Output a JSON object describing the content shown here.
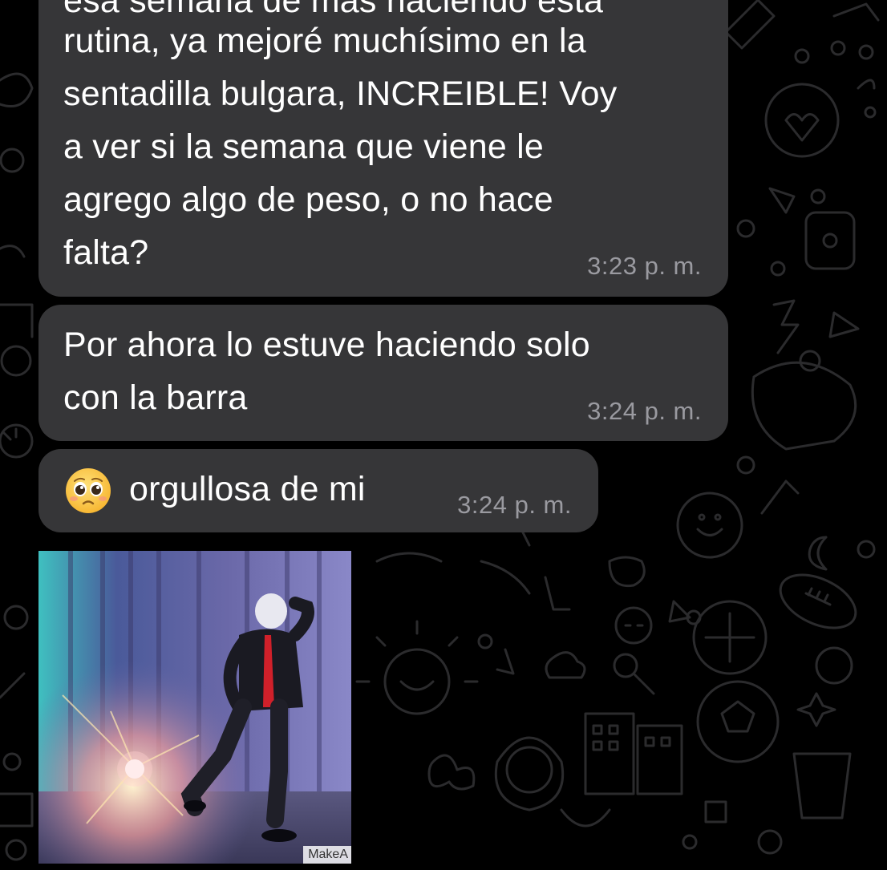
{
  "chat": {
    "messages": [
      {
        "partial_line": "esa semana de mas haciendo esta",
        "text": "rutina, ya mejoré muchísimo en la\nsentadilla bulgara, INCREIBLE! Voy\na ver si la semana que viene le\nagrego algo de peso, o no hace\nfalta?",
        "time": "3:23 p. m."
      },
      {
        "text": "Por ahora lo estuve haciendo solo\ncon la barra",
        "time": "3:24 p. m."
      },
      {
        "emoji": "pleading-face-icon",
        "text": "orgullosa de mi",
        "time": "3:24 p. m."
      }
    ],
    "gif": {
      "watermark": "MakeA",
      "description_icon": "dancing-man-gif"
    }
  },
  "colors": {
    "background": "#000000",
    "bubble": "#363638",
    "text": "#ffffff",
    "time": "#9a9aa0",
    "wallpaper_doodle": "#2a2a2c"
  }
}
